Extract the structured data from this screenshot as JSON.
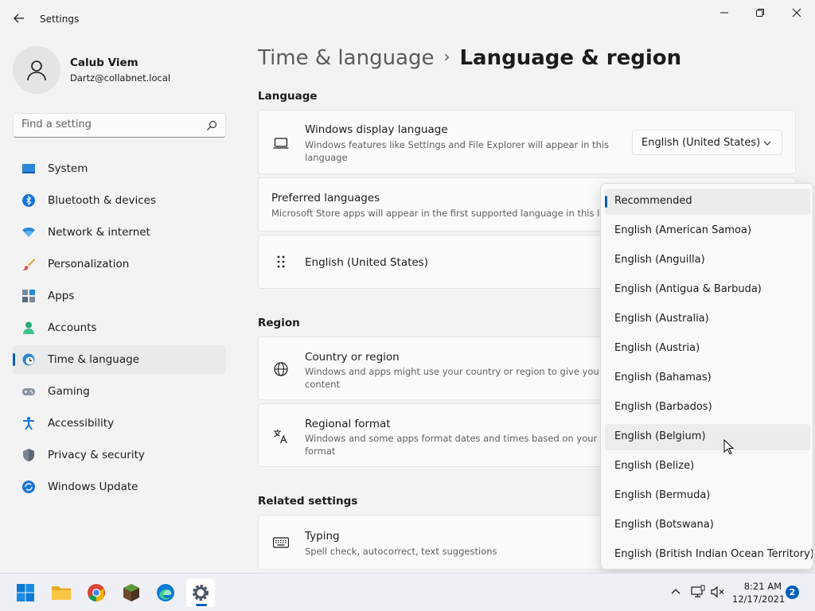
{
  "window": {
    "title": "Settings"
  },
  "profile": {
    "name": "Calub Viem",
    "email": "Dartz@collabnet.local"
  },
  "search": {
    "placeholder": "Find a setting"
  },
  "nav": {
    "items": [
      {
        "label": "System",
        "icon": "monitor-icon"
      },
      {
        "label": "Bluetooth & devices",
        "icon": "bluetooth-icon"
      },
      {
        "label": "Network & internet",
        "icon": "wifi-icon"
      },
      {
        "label": "Personalization",
        "icon": "brush-icon"
      },
      {
        "label": "Apps",
        "icon": "apps-icon"
      },
      {
        "label": "Accounts",
        "icon": "person-icon"
      },
      {
        "label": "Time & language",
        "icon": "clock-globe-icon",
        "selected": true
      },
      {
        "label": "Gaming",
        "icon": "gamepad-icon"
      },
      {
        "label": "Accessibility",
        "icon": "accessibility-icon"
      },
      {
        "label": "Privacy & security",
        "icon": "shield-icon"
      },
      {
        "label": "Windows Update",
        "icon": "update-icon"
      }
    ]
  },
  "breadcrumb": {
    "parent": "Time & language",
    "separator": "›",
    "current": "Language & region"
  },
  "language": {
    "section_title": "Language",
    "display": {
      "title": "Windows display language",
      "desc_line1": "Windows features like Settings and File Explorer will appear in this",
      "desc_line2": "language",
      "selected": "English (United States)"
    },
    "preferred": {
      "title": "Preferred languages",
      "desc": "Microsoft Store apps will appear in the first supported language in this list"
    },
    "installed": {
      "label": "English (United States)"
    }
  },
  "region": {
    "section_title": "Region",
    "country": {
      "title": "Country or region",
      "desc_line1": "Windows and apps might use your country or region to give you loca",
      "desc_line2": "content"
    },
    "format": {
      "title": "Regional format",
      "desc_line1": "Windows and some apps format dates and times based on your regio",
      "desc_line2": "format"
    }
  },
  "related": {
    "section_title": "Related settings",
    "typing": {
      "title": "Typing",
      "desc": "Spell check, autocorrect, text suggestions"
    }
  },
  "dropdown": {
    "selected_index": 0,
    "hover_index": 8,
    "options": [
      "Recommended",
      "English (American Samoa)",
      "English (Anguilla)",
      "English (Antigua & Barbuda)",
      "English (Australia)",
      "English (Austria)",
      "English (Bahamas)",
      "English (Barbados)",
      "English (Belgium)",
      "English (Belize)",
      "English (Bermuda)",
      "English (Botswana)",
      "English (British Indian Ocean Territory)"
    ]
  },
  "taskbar": {
    "apps": [
      "start-icon",
      "file-explorer-icon",
      "chrome-icon",
      "minecraft-icon",
      "edge-icon",
      "settings-icon"
    ],
    "time": "8:21 AM",
    "date": "12/17/2021",
    "notification_count": "2"
  },
  "colors": {
    "accent": "#005fb8",
    "background": "#f3f3f3",
    "card": "#fbfbfb"
  }
}
